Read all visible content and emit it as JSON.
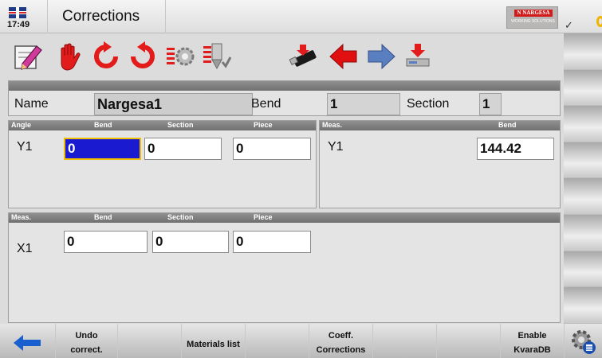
{
  "titlebar": {
    "time": "17:49",
    "title": "Corrections",
    "logo_line1": "N NARGESA",
    "logo_line2": "WORKING SOLUTIONS",
    "flag": "uk-flag-icon"
  },
  "toolbar": {
    "icons": [
      "edit-pencil-icon",
      "stop-hand-icon",
      "refresh-left-icon",
      "refresh-right-icon",
      "settings-list-icon",
      "tooling-icon",
      "usb-drive-icon",
      "back-arrow-icon",
      "forward-arrow-icon",
      "import-icon"
    ]
  },
  "info": {
    "name_label": "Name",
    "name_value": "Nargesa1",
    "bend_label": "Bend",
    "bend_value": "1",
    "section_label": "Section",
    "section_value": "1"
  },
  "angle": {
    "headers": [
      "Angle",
      "Bend",
      "Section",
      "Piece"
    ],
    "row_label": "Y1",
    "values": [
      "0",
      "0",
      "0"
    ]
  },
  "meas_y": {
    "headers": [
      "Meas.",
      "Bend"
    ],
    "row_label": "Y1",
    "value": "144.42"
  },
  "meas_x": {
    "headers": [
      "Meas.",
      "Bend",
      "Section",
      "Piece"
    ],
    "row_label": "X1",
    "values": [
      "0",
      "0",
      "0"
    ]
  },
  "bottom": {
    "back_icon": "back-arrow-icon",
    "undo_line1": "Undo",
    "undo_line2": "correct.",
    "materials": "Materials list",
    "coeff_line1": "Coeff.",
    "coeff_line2": "Corrections",
    "enable_line1": "Enable",
    "enable_line2": "KvaraDB",
    "settings_icon": "gear-database-icon"
  },
  "colors": {
    "selected_field": "#1a1ad0",
    "selected_border": "#f0c000",
    "panel_header": "#808080",
    "arrow_red": "#e01010",
    "arrow_blue": "#5a7fc0"
  }
}
